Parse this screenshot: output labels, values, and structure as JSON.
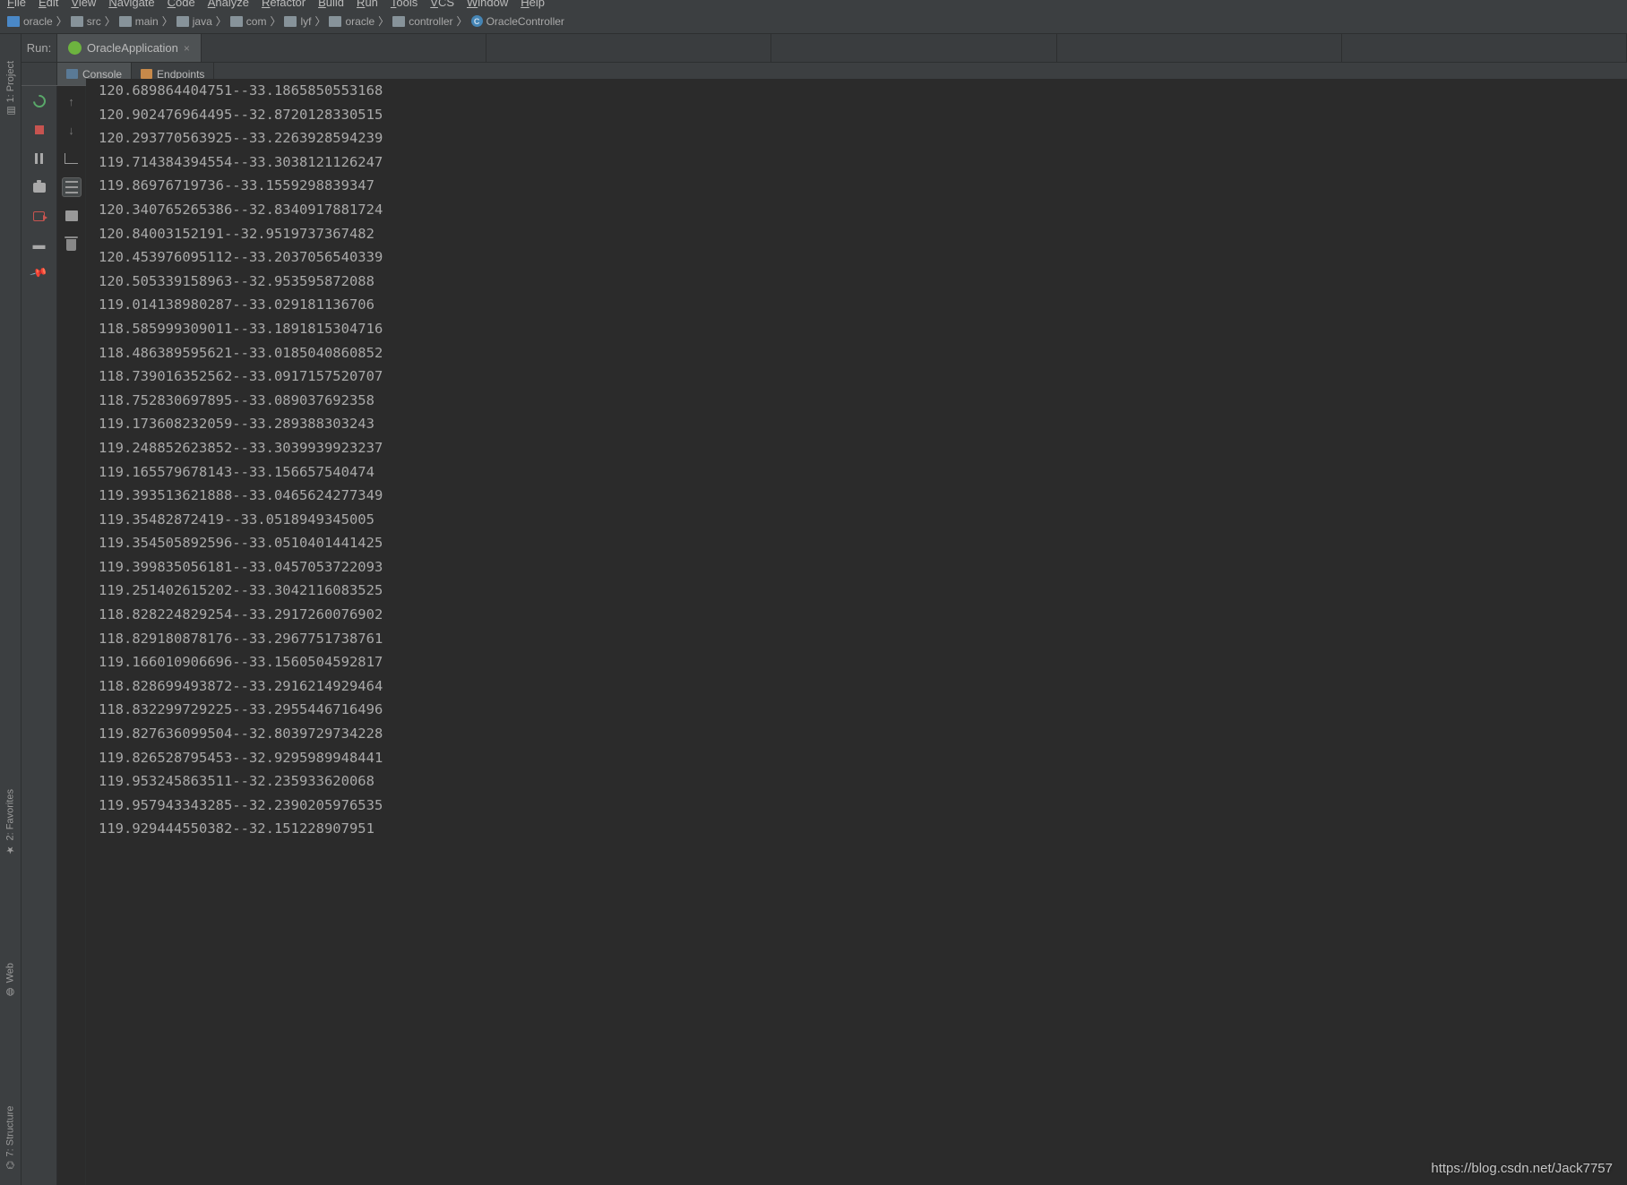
{
  "menu": [
    "File",
    "Edit",
    "View",
    "Navigate",
    "Code",
    "Analyze",
    "Refactor",
    "Build",
    "Run",
    "Tools",
    "VCS",
    "Window",
    "Help"
  ],
  "breadcrumbs": [
    {
      "label": "oracle",
      "type": "module"
    },
    {
      "label": "src",
      "type": "folder"
    },
    {
      "label": "main",
      "type": "folder"
    },
    {
      "label": "java",
      "type": "folder"
    },
    {
      "label": "com",
      "type": "folder"
    },
    {
      "label": "lyf",
      "type": "folder"
    },
    {
      "label": "oracle",
      "type": "folder"
    },
    {
      "label": "controller",
      "type": "folder"
    },
    {
      "label": "OracleController",
      "type": "class"
    }
  ],
  "runLabel": "Run:",
  "runTab": "OracleApplication",
  "subtabs": {
    "console": "Console",
    "endpoints": "Endpoints"
  },
  "leftTools": {
    "project": "1: Project",
    "favorites": "2: Favorites",
    "web": "Web",
    "structure": "7: Structure"
  },
  "watermark": "https://blog.csdn.net/Jack7757",
  "consoleLines": [
    "120.689864404751--33.1865850553168",
    "120.902476964495--32.8720128330515",
    "120.293770563925--33.2263928594239",
    "119.714384394554--33.3038121126247",
    "119.86976719736--33.1559298839347",
    "120.340765265386--32.8340917881724",
    "120.84003152191--32.9519737367482",
    "120.453976095112--33.2037056540339",
    "120.505339158963--32.953595872088",
    "119.014138980287--33.029181136706",
    "118.585999309011--33.1891815304716",
    "118.486389595621--33.0185040860852",
    "118.739016352562--33.0917157520707",
    "118.752830697895--33.089037692358",
    "119.173608232059--33.289388303243",
    "119.248852623852--33.3039939923237",
    "119.165579678143--33.156657540474",
    "119.393513621888--33.0465624277349",
    "119.35482872419--33.0518949345005",
    "119.354505892596--33.0510401441425",
    "119.399835056181--33.0457053722093",
    "119.251402615202--33.3042116083525",
    "118.828224829254--33.2917260076902",
    "118.829180878176--33.2967751738761",
    "119.166010906696--33.1560504592817",
    "118.828699493872--33.2916214929464",
    "118.832299729225--33.2955446716496",
    "119.827636099504--32.8039729734228",
    "119.826528795453--32.9295989948441",
    "119.953245863511--32.235933620068",
    "119.957943343285--32.2390205976535",
    "119.929444550382--32.151228907951"
  ]
}
